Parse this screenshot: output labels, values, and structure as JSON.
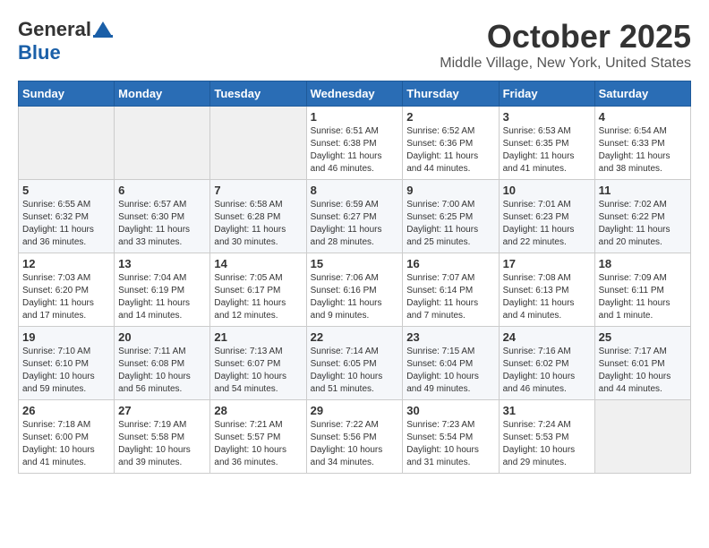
{
  "header": {
    "logo_general": "General",
    "logo_blue": "Blue",
    "month_title": "October 2025",
    "location": "Middle Village, New York, United States"
  },
  "weekdays": [
    "Sunday",
    "Monday",
    "Tuesday",
    "Wednesday",
    "Thursday",
    "Friday",
    "Saturday"
  ],
  "weeks": [
    [
      {
        "day": "",
        "info": ""
      },
      {
        "day": "",
        "info": ""
      },
      {
        "day": "",
        "info": ""
      },
      {
        "day": "1",
        "info": "Sunrise: 6:51 AM\nSunset: 6:38 PM\nDaylight: 11 hours and 46 minutes."
      },
      {
        "day": "2",
        "info": "Sunrise: 6:52 AM\nSunset: 6:36 PM\nDaylight: 11 hours and 44 minutes."
      },
      {
        "day": "3",
        "info": "Sunrise: 6:53 AM\nSunset: 6:35 PM\nDaylight: 11 hours and 41 minutes."
      },
      {
        "day": "4",
        "info": "Sunrise: 6:54 AM\nSunset: 6:33 PM\nDaylight: 11 hours and 38 minutes."
      }
    ],
    [
      {
        "day": "5",
        "info": "Sunrise: 6:55 AM\nSunset: 6:32 PM\nDaylight: 11 hours and 36 minutes."
      },
      {
        "day": "6",
        "info": "Sunrise: 6:57 AM\nSunset: 6:30 PM\nDaylight: 11 hours and 33 minutes."
      },
      {
        "day": "7",
        "info": "Sunrise: 6:58 AM\nSunset: 6:28 PM\nDaylight: 11 hours and 30 minutes."
      },
      {
        "day": "8",
        "info": "Sunrise: 6:59 AM\nSunset: 6:27 PM\nDaylight: 11 hours and 28 minutes."
      },
      {
        "day": "9",
        "info": "Sunrise: 7:00 AM\nSunset: 6:25 PM\nDaylight: 11 hours and 25 minutes."
      },
      {
        "day": "10",
        "info": "Sunrise: 7:01 AM\nSunset: 6:23 PM\nDaylight: 11 hours and 22 minutes."
      },
      {
        "day": "11",
        "info": "Sunrise: 7:02 AM\nSunset: 6:22 PM\nDaylight: 11 hours and 20 minutes."
      }
    ],
    [
      {
        "day": "12",
        "info": "Sunrise: 7:03 AM\nSunset: 6:20 PM\nDaylight: 11 hours and 17 minutes."
      },
      {
        "day": "13",
        "info": "Sunrise: 7:04 AM\nSunset: 6:19 PM\nDaylight: 11 hours and 14 minutes."
      },
      {
        "day": "14",
        "info": "Sunrise: 7:05 AM\nSunset: 6:17 PM\nDaylight: 11 hours and 12 minutes."
      },
      {
        "day": "15",
        "info": "Sunrise: 7:06 AM\nSunset: 6:16 PM\nDaylight: 11 hours and 9 minutes."
      },
      {
        "day": "16",
        "info": "Sunrise: 7:07 AM\nSunset: 6:14 PM\nDaylight: 11 hours and 7 minutes."
      },
      {
        "day": "17",
        "info": "Sunrise: 7:08 AM\nSunset: 6:13 PM\nDaylight: 11 hours and 4 minutes."
      },
      {
        "day": "18",
        "info": "Sunrise: 7:09 AM\nSunset: 6:11 PM\nDaylight: 11 hours and 1 minute."
      }
    ],
    [
      {
        "day": "19",
        "info": "Sunrise: 7:10 AM\nSunset: 6:10 PM\nDaylight: 10 hours and 59 minutes."
      },
      {
        "day": "20",
        "info": "Sunrise: 7:11 AM\nSunset: 6:08 PM\nDaylight: 10 hours and 56 minutes."
      },
      {
        "day": "21",
        "info": "Sunrise: 7:13 AM\nSunset: 6:07 PM\nDaylight: 10 hours and 54 minutes."
      },
      {
        "day": "22",
        "info": "Sunrise: 7:14 AM\nSunset: 6:05 PM\nDaylight: 10 hours and 51 minutes."
      },
      {
        "day": "23",
        "info": "Sunrise: 7:15 AM\nSunset: 6:04 PM\nDaylight: 10 hours and 49 minutes."
      },
      {
        "day": "24",
        "info": "Sunrise: 7:16 AM\nSunset: 6:02 PM\nDaylight: 10 hours and 46 minutes."
      },
      {
        "day": "25",
        "info": "Sunrise: 7:17 AM\nSunset: 6:01 PM\nDaylight: 10 hours and 44 minutes."
      }
    ],
    [
      {
        "day": "26",
        "info": "Sunrise: 7:18 AM\nSunset: 6:00 PM\nDaylight: 10 hours and 41 minutes."
      },
      {
        "day": "27",
        "info": "Sunrise: 7:19 AM\nSunset: 5:58 PM\nDaylight: 10 hours and 39 minutes."
      },
      {
        "day": "28",
        "info": "Sunrise: 7:21 AM\nSunset: 5:57 PM\nDaylight: 10 hours and 36 minutes."
      },
      {
        "day": "29",
        "info": "Sunrise: 7:22 AM\nSunset: 5:56 PM\nDaylight: 10 hours and 34 minutes."
      },
      {
        "day": "30",
        "info": "Sunrise: 7:23 AM\nSunset: 5:54 PM\nDaylight: 10 hours and 31 minutes."
      },
      {
        "day": "31",
        "info": "Sunrise: 7:24 AM\nSunset: 5:53 PM\nDaylight: 10 hours and 29 minutes."
      },
      {
        "day": "",
        "info": ""
      }
    ]
  ]
}
